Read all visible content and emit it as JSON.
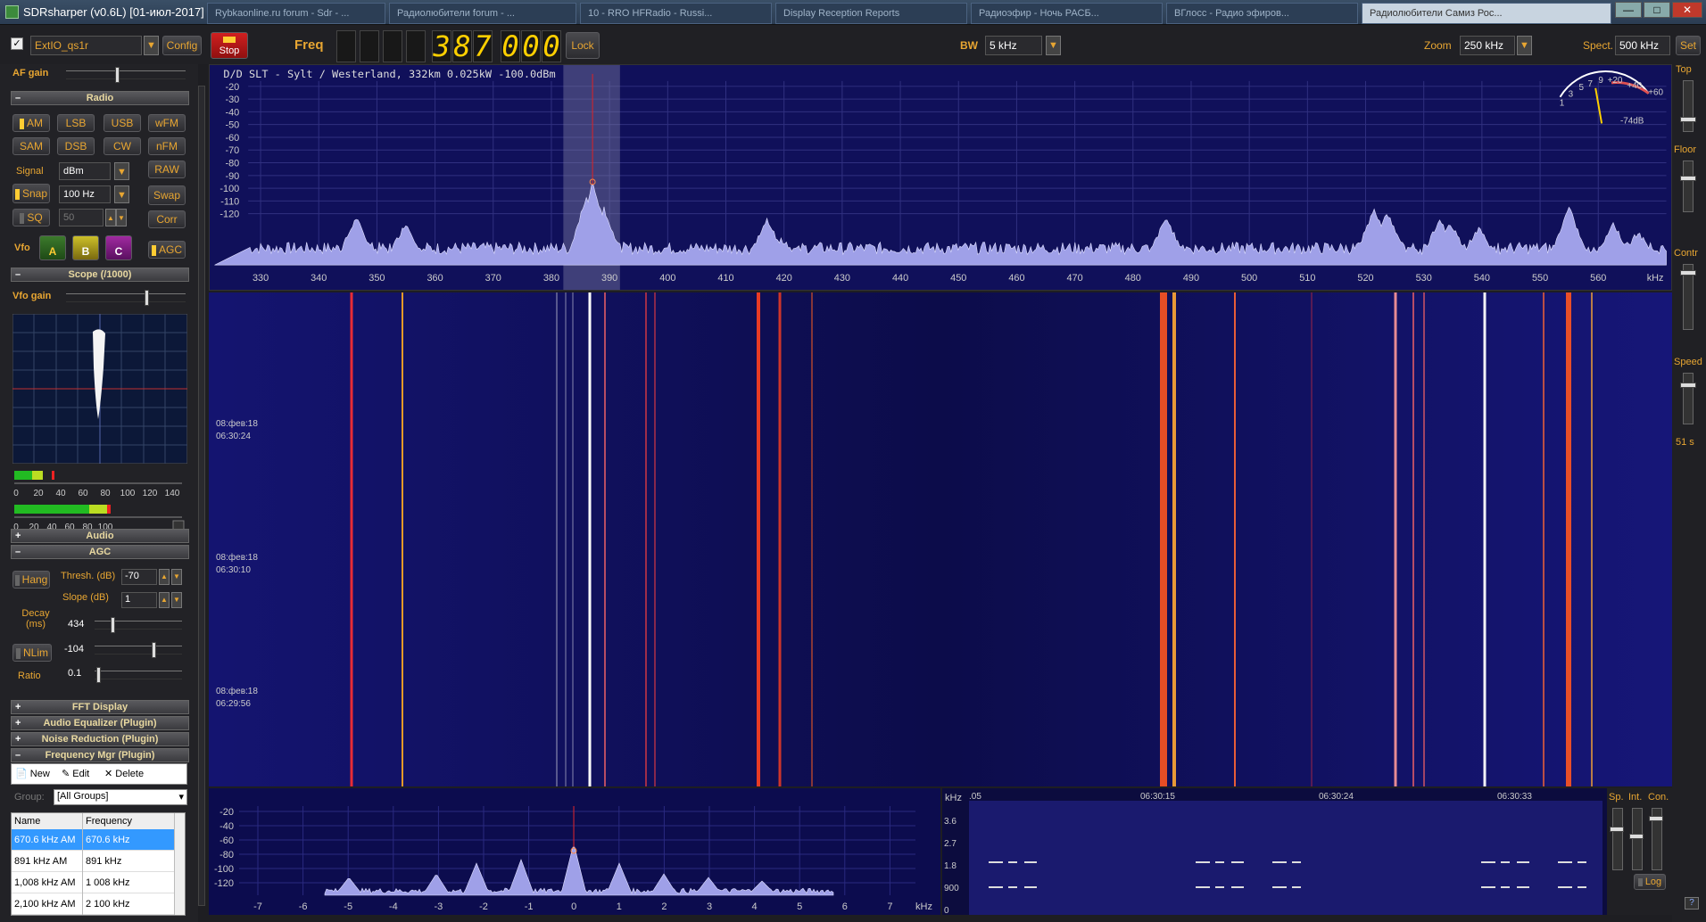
{
  "window": {
    "title": "SDRsharper (v0.6L) [01-июл-2017]",
    "browser_tabs": [
      "Rybkaonline.ru forum - Sdr - ...",
      "Радиолюбители forum - ...",
      "10 - RRO HFRadio - Russi...",
      "Display Reception Reports",
      "Радиоэфир - Ночь РАСБ...",
      "ВГлосс - Радио эфиров...",
      "Радиолюбители Самиз Рос..."
    ],
    "btn_minimize": "—",
    "btn_maximize": "□",
    "btn_close": "✕"
  },
  "toolbar": {
    "source_checkbox": "✓",
    "source": "ExtIO_qs1r",
    "config_label": "Config",
    "stop_label": "Stop",
    "freq_label": "Freq",
    "freq_digits": [
      "3",
      "8",
      "7",
      "0",
      "0",
      "0"
    ],
    "lock_label": "Lock",
    "bw_label": "BW",
    "bw_value": "5 kHz",
    "zoom_label": "Zoom",
    "zoom_value": "250 kHz",
    "spect_label": "Spect.",
    "spect_value": "500 kHz",
    "set_label": "Set"
  },
  "left": {
    "af_gain_label": "AF gain",
    "af_gain_level": 0.42,
    "radio_header": "Radio",
    "modes": [
      "AM",
      "LSB",
      "USB",
      "wFM",
      "SAM",
      "DSB",
      "CW",
      "nFM"
    ],
    "active_mode": "AM",
    "signal_label": "Signal",
    "signal_value": "dBm",
    "raw_label": "RAW",
    "snap_label": "Snap",
    "snap_value": "100 Hz",
    "swap_label": "Swap",
    "sq_label": "SQ",
    "sq_value": "50",
    "corr_label": "Corr",
    "vfo_label": "Vfo",
    "vfo_a": "A",
    "vfo_b": "B",
    "vfo_c": "C",
    "agc_btn": "AGC",
    "scope_header": "Scope (/1000)",
    "vfo_gain_label": "Vfo gain",
    "vfo_gain_level": 0.68,
    "meter1_ticks": [
      "0",
      "20",
      "40",
      "60",
      "80",
      "100",
      "120",
      "140"
    ],
    "meter2_ticks": [
      "0",
      "20",
      "40",
      "60",
      "80",
      "100"
    ],
    "audio_header": "Audio",
    "agc_header": "AGC",
    "hang_label": "Hang",
    "thresh_label": "Thresh. (dB)",
    "thresh_value": "-70",
    "slope_label": "Slope (dB)",
    "slope_value": "1",
    "decay_label": "Decay (ms)",
    "decay_value": "434",
    "nlim_label": "NLim",
    "nlim_value": "-104",
    "ratio_label": "Ratio",
    "ratio_value": "0.1",
    "fft_header": "FFT Display",
    "eq_header": "Audio Equalizer (Plugin)",
    "nr_header": "Noise Reduction (Plugin)",
    "fmgr_header": "Frequency Mgr (Plugin)",
    "fmgr_new": "New",
    "fmgr_edit": "Edit",
    "fmgr_delete": "Delete",
    "group_label": "Group:",
    "group_value": "[All Groups]",
    "table_headers": [
      "Name",
      "Frequency"
    ],
    "table_rows": [
      {
        "name": "670.6 kHz AM",
        "freq": "670.6 kHz"
      },
      {
        "name": "891 kHz AM",
        "freq": "891 kHz"
      },
      {
        "name": "1,008 kHz AM",
        "freq": "1 008 kHz"
      },
      {
        "name": "2,100 kHz AM",
        "freq": "2 100 kHz"
      }
    ]
  },
  "spectrum": {
    "info": "D/D SLT - Sylt / Westerland, 332km 0.025kW -100.0dBm",
    "y_ticks": [
      "-20",
      "-30",
      "-40",
      "-50",
      "-60",
      "-70",
      "-80",
      "-90",
      "-100",
      "-110",
      "-120"
    ],
    "x_ticks": [
      "330",
      "340",
      "350",
      "360",
      "370",
      "380",
      "390",
      "400",
      "410",
      "420",
      "430",
      "440",
      "450",
      "460",
      "470",
      "480",
      "490",
      "500",
      "510",
      "520",
      "530",
      "540",
      "550",
      "560"
    ],
    "x_unit": "kHz",
    "meter_scale": [
      "1",
      "3",
      "5",
      "7",
      "9",
      "+20",
      "+40",
      "+60"
    ],
    "meter_value": "-74dB"
  },
  "waterfall": {
    "timestamps": [
      {
        "date": "08:фев:18",
        "time": "06:30:24"
      },
      {
        "date": "08:фев:18",
        "time": "06:30:10"
      },
      {
        "date": "08:фев:18",
        "time": "06:29:56"
      }
    ]
  },
  "audio_scope": {
    "y_ticks": [
      "-20",
      "-40",
      "-60",
      "-80",
      "-100",
      "-120"
    ],
    "x_ticks": [
      "-7",
      "-6",
      "-5",
      "-4",
      "-3",
      "-2",
      "-1",
      "0",
      "1",
      "2",
      "3",
      "4",
      "5",
      "6",
      "7"
    ],
    "x_unit": "kHz"
  },
  "audio_wf": {
    "unit": "kHz",
    "y_ticks": [
      "3.6",
      "2.7",
      "1.8",
      "900",
      "0"
    ],
    "x_ticks": [
      ".05",
      "06:30:15",
      "06:30:24",
      "06:30:33"
    ],
    "sp_label": "Sp.",
    "int_label": "Int.",
    "con_label": "Con.",
    "log_label": "Log"
  },
  "right": {
    "top_label": "Top",
    "floor_label": "Floor",
    "contr_label": "Contr",
    "speed_label": "Speed",
    "speed_value": "51 s",
    "help_label": "?"
  },
  "colors": {
    "accent": "#e8a632",
    "digits": "#ffd000",
    "stop_red": "#cc1a1a",
    "spectrum_bg": "#10105a"
  }
}
